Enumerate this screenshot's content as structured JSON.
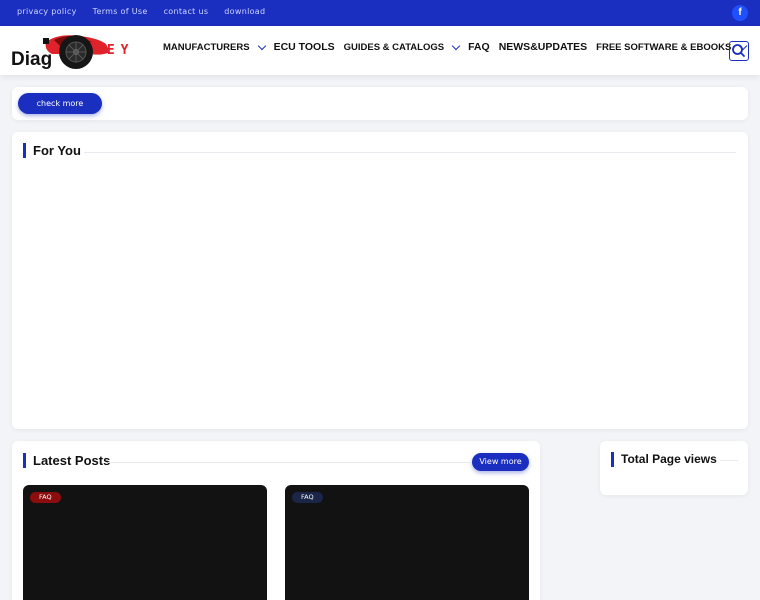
{
  "topbar": {
    "links": [
      "privacy policy",
      "Terms of Use",
      "contact us",
      "download"
    ],
    "facebook_glyph": "f"
  },
  "logo": {
    "part1": "Diag",
    "part2": "KEY"
  },
  "nav": {
    "items": [
      {
        "label": "MANUFACTURERS",
        "has_dropdown": true
      },
      {
        "label": "ECU TOOLS",
        "has_dropdown": false
      },
      {
        "label": "GUIDES & CATALOGS",
        "has_dropdown": true
      },
      {
        "label": "FAQ",
        "has_dropdown": false
      },
      {
        "label": "NEWS&UPDATES",
        "has_dropdown": false
      },
      {
        "label": "FREE SOFTWARE & EBOOKS",
        "has_dropdown": true
      }
    ]
  },
  "banner": {
    "button_label": "check more"
  },
  "for_you": {
    "title": "For You"
  },
  "latest": {
    "title": "Latest Posts",
    "view_more_label": "View more",
    "posts": [
      {
        "tag": "FAQ",
        "tag_color": "#8b0d0d"
      },
      {
        "tag": "FAQ",
        "tag_color": "#1a2547"
      }
    ]
  },
  "sidebar": {
    "title": "Total Page views"
  },
  "colors": {
    "brand_blue": "#1a2fc0",
    "logo_red": "#e0232b",
    "background": "#f2f4f8"
  }
}
